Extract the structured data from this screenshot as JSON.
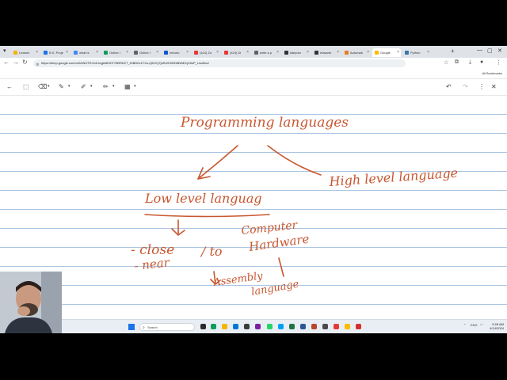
{
  "browser": {
    "tabs": [
      {
        "label": "Learnin",
        "color": "#f4b400"
      },
      {
        "label": "B.S. Proje",
        "color": "#1a73e8"
      },
      {
        "label": "what is",
        "color": "#4285f4"
      },
      {
        "label": "Online I",
        "color": "#0f9d58"
      },
      {
        "label": "Online I",
        "color": "#5f6368"
      },
      {
        "label": "Introdu",
        "color": "#0b57d0"
      },
      {
        "label": "(424) Zo",
        "color": "#e53935"
      },
      {
        "label": "(424) Di",
        "color": "#e53935"
      },
      {
        "label": "write a p",
        "color": "#5f6368"
      },
      {
        "label": "sitepoin",
        "color": "#333333"
      },
      {
        "label": "edwardi",
        "color": "#333333"
      },
      {
        "label": "Automati",
        "color": "#e67e22"
      },
      {
        "label": "Google",
        "color": "#fbbc04"
      },
      {
        "label": "Python",
        "color": "#3776ab"
      }
    ],
    "new_tab": "+",
    "url": "https://keep.google.com/u/0/#NOTE/1vKUqjsMKtH775BRKZT_iGBDh11YXu-QiK2Q7jdSIJK9ElDt8WiE2yHtoP_UoxBoU",
    "bookmarks_label": "All Bookmarks"
  },
  "handwriting": {
    "title": "Programming languages",
    "left_branch": "Low level languag",
    "right_branch": "High level language",
    "note_computer": "Computer",
    "note_close": "- close",
    "note_near": "- near",
    "note_slash_to": "/ to",
    "note_hardware": "Hardware",
    "note_assembly": "Assembly",
    "note_language": "language",
    "ink_color": "#c8562f"
  },
  "taskbar": {
    "search_placeholder": "Search",
    "lang": "ENG",
    "lang2": "US",
    "time": "5:28 AM",
    "date": "4/14/2024"
  }
}
